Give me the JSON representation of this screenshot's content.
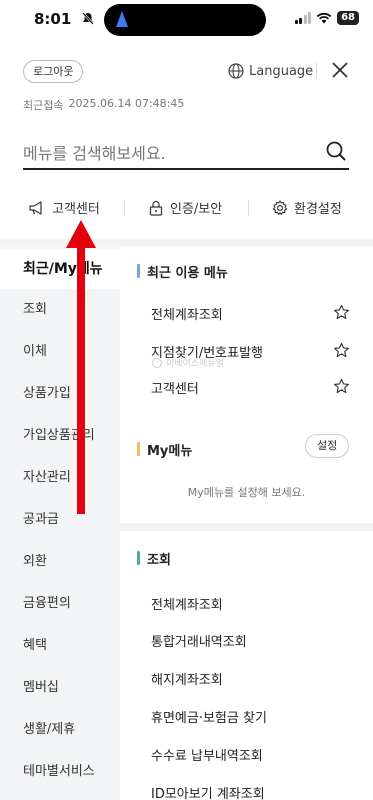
{
  "status_bar": {
    "time": "8:01",
    "battery": "68"
  },
  "header": {
    "logout_label": "로그아웃",
    "language_label": "Language",
    "last_login_label": "최근접속",
    "last_login_value": "2025.06.14 07:48:45"
  },
  "search": {
    "placeholder": "메뉴를 검색해보세요."
  },
  "quick_links": [
    {
      "label": "고객센터",
      "icon": "megaphone-icon"
    },
    {
      "label": "인증/보안",
      "icon": "lock-icon"
    },
    {
      "label": "환경설정",
      "icon": "gear-icon"
    }
  ],
  "categories": [
    {
      "label": "최근/My메뉴",
      "active": true
    },
    {
      "label": "조회"
    },
    {
      "label": "이체"
    },
    {
      "label": "상품가입"
    },
    {
      "label": "가입상품관리"
    },
    {
      "label": "자산관리"
    },
    {
      "label": "공과금"
    },
    {
      "label": "외환"
    },
    {
      "label": "금융편의"
    },
    {
      "label": "혜택"
    },
    {
      "label": "멤버십"
    },
    {
      "label": "생활/제휴"
    },
    {
      "label": "테마별서비스"
    }
  ],
  "recent_section": {
    "title": "최근 이용 메뉴",
    "accent": "#7aa6d8",
    "items": [
      "전체계좌조회",
      "지점찾기/번호표발행",
      "고객센터"
    ]
  },
  "my_menu": {
    "title": "My메뉴",
    "accent": "#f2c14e",
    "setting_label": "설정",
    "empty_message": "My메뉴를 설정해 보세요."
  },
  "inquiry_section": {
    "title": "조회",
    "accent": "#4caf8e",
    "items": [
      "전체계좌조회",
      "통합거래내역조회",
      "해지계좌조회",
      "휴면예금·보험금 찾기",
      "수수료 납부내역조회",
      "ID모아보기 계좌조회"
    ]
  },
  "watermark": "이베이스메뉴얼",
  "colors": {
    "annotation_arrow": "#e3000f",
    "category_background": "#f3f4f6"
  }
}
